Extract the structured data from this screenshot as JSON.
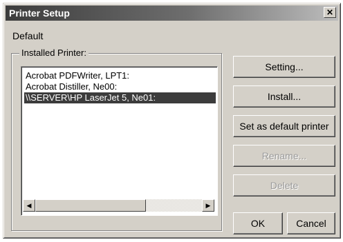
{
  "window": {
    "title": "Printer Setup",
    "close_label": "✕"
  },
  "default_label": "Default",
  "installed_group": {
    "legend": "Installed Printer:",
    "printers": [
      "Acrobat PDFWriter, LPT1:",
      "Acrobat Distiller, Ne00:",
      "\\\\SERVER\\HP LaserJet 5, Ne01:"
    ],
    "selected_index": 2
  },
  "scrollbar": {
    "left_arrow": "◀",
    "right_arrow": "▶"
  },
  "buttons": {
    "setting": "Setting...",
    "install": "Install...",
    "set_default": "Set as default printer",
    "rename": "Rename...",
    "delete": "Delete",
    "ok": "OK",
    "cancel": "Cancel"
  },
  "colors": {
    "selection": "#3c3c3c",
    "dialog_bg": "#d4d0c8"
  }
}
